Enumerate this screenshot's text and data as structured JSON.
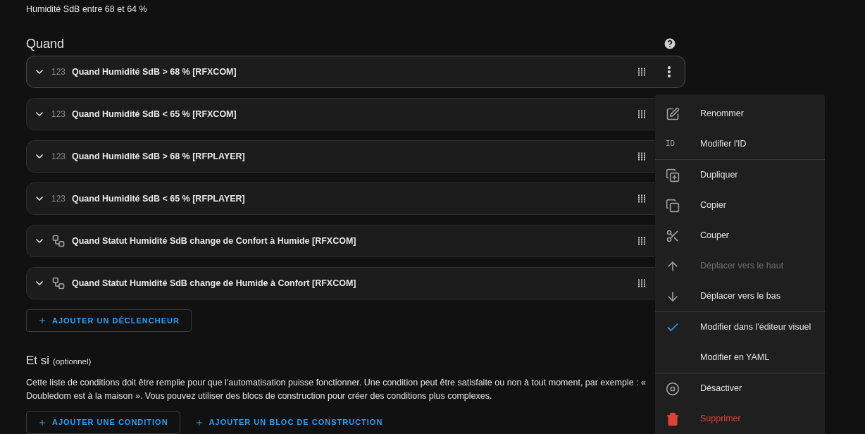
{
  "description": "Humidité SdB entre 68 et 64 %",
  "triggers_section": {
    "title": "Quand",
    "rows": [
      {
        "kind": "numeric",
        "icon_text": "123",
        "label": "Quand Humidité SdB > 68 % [RFXCOM]",
        "menu_open": true
      },
      {
        "kind": "numeric",
        "icon_text": "123",
        "label": "Quand Humidité SdB < 65 % [RFXCOM]",
        "menu_open": false
      },
      {
        "kind": "numeric",
        "icon_text": "123",
        "label": "Quand Humidité SdB > 68 % [RFPLAYER]",
        "menu_open": false
      },
      {
        "kind": "numeric",
        "icon_text": "123",
        "label": "Quand Humidité SdB < 65 % [RFPLAYER]",
        "menu_open": false
      },
      {
        "kind": "state",
        "label": "Quand Statut Humidité SdB change de Confort à Humide [RFXCOM]",
        "menu_open": false
      },
      {
        "kind": "state",
        "label": "Quand Statut Humidité SdB change de Humide à Confort [RFXCOM]",
        "menu_open": false
      }
    ],
    "add_button": "AJOUTER UN DÉCLENCHEUR"
  },
  "conditions_section": {
    "title": "Et si",
    "subtitle": "(optionnel)",
    "text": "Cette liste de conditions doit être remplie pour que l'automatisation puisse fonctionner. Une condition peut être satisfaite ou non à tout moment, par exemple : « Doubledom est à la maison ». Vous pouvez utiliser des blocs de construction pour créer des conditions plus complexes.",
    "buttons": [
      {
        "label": "AJOUTER UNE CONDITION",
        "outlined": true
      },
      {
        "label": "AJOUTER UN BLOC DE CONSTRUCTION",
        "outlined": false
      }
    ]
  },
  "menu": {
    "sections": [
      [
        {
          "kind": "rename",
          "label": "Renommer",
          "disabled": false
        },
        {
          "kind": "id",
          "icon_text": "ID",
          "label": "Modifier l'ID",
          "disabled": false
        }
      ],
      [
        {
          "kind": "duplicate",
          "label": "Dupliquer",
          "disabled": false
        },
        {
          "kind": "copy",
          "label": "Copier",
          "disabled": false
        },
        {
          "kind": "cut",
          "label": "Couper",
          "disabled": false
        },
        {
          "kind": "up",
          "label": "Déplacer vers le haut",
          "disabled": true
        },
        {
          "kind": "down",
          "label": "Déplacer vers le bas",
          "disabled": false
        }
      ],
      [
        {
          "kind": "mode",
          "label": "Modifier dans l'éditeur visuel",
          "checked": true,
          "disabled": false
        },
        {
          "kind": "mode",
          "label": "Modifier en YAML",
          "checked": false,
          "disabled": false
        }
      ],
      [
        {
          "kind": "disable",
          "label": "Désactiver",
          "disabled": false
        },
        {
          "kind": "delete",
          "label": "Supprimer",
          "disabled": false
        }
      ]
    ]
  }
}
